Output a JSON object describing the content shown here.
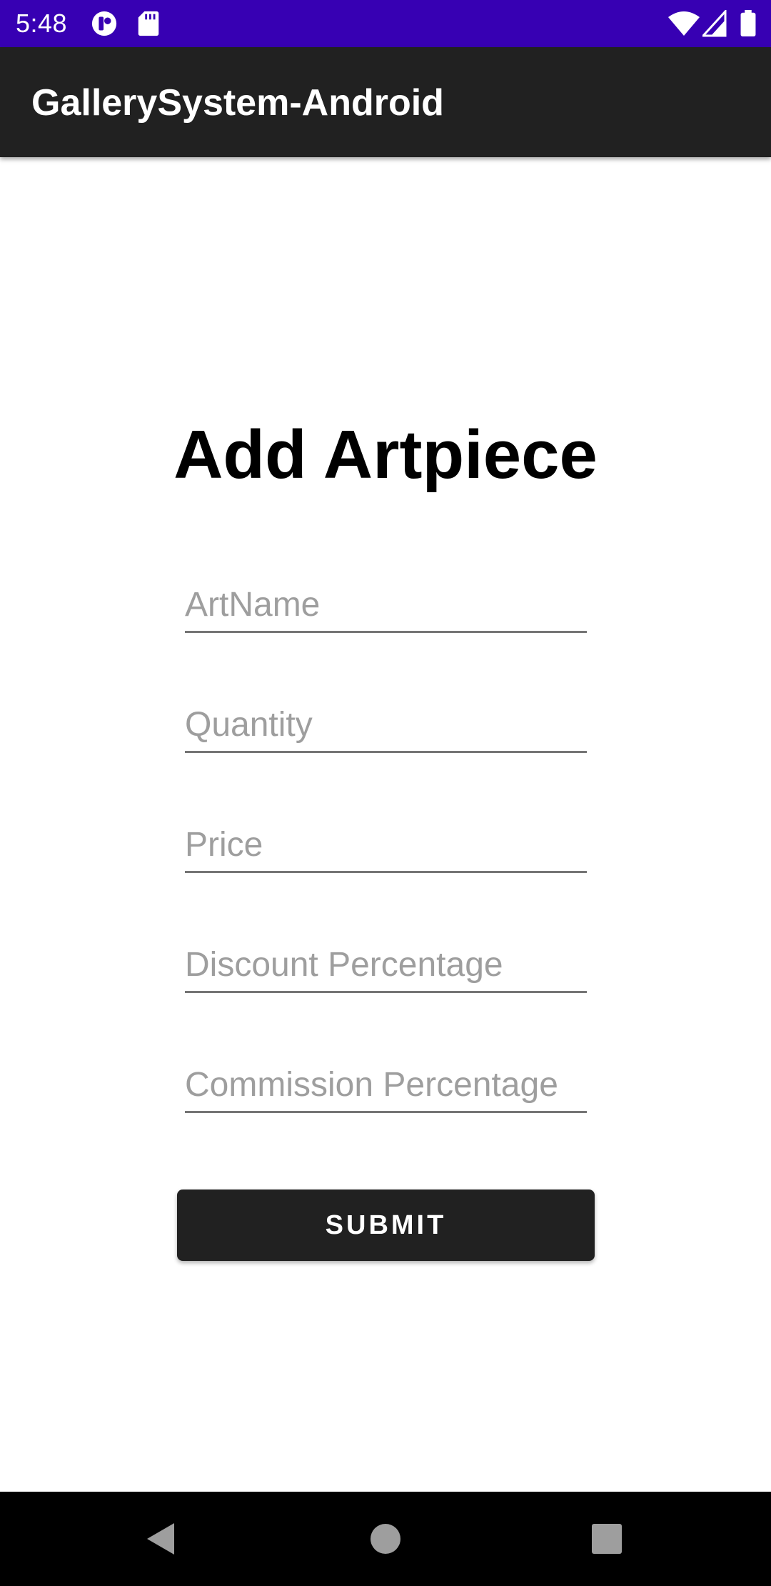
{
  "status_bar": {
    "time": "5:48",
    "color": "#3700b3",
    "icons": [
      "notification-app-icon",
      "sd-card-icon",
      "wifi-icon",
      "signal-icon",
      "battery-icon"
    ]
  },
  "app_bar": {
    "title": "GallerySystem-Android",
    "color": "#212121"
  },
  "form": {
    "heading": "Add Artpiece",
    "fields": [
      {
        "placeholder": "ArtName",
        "value": ""
      },
      {
        "placeholder": "Quantity",
        "value": ""
      },
      {
        "placeholder": "Price",
        "value": ""
      },
      {
        "placeholder": "Discount Percentage",
        "value": ""
      },
      {
        "placeholder": "Commission Percentage",
        "value": ""
      }
    ],
    "submit_label": "SUBMIT"
  },
  "nav_bar": {
    "icons": [
      "back-icon",
      "home-icon",
      "recents-icon"
    ]
  }
}
